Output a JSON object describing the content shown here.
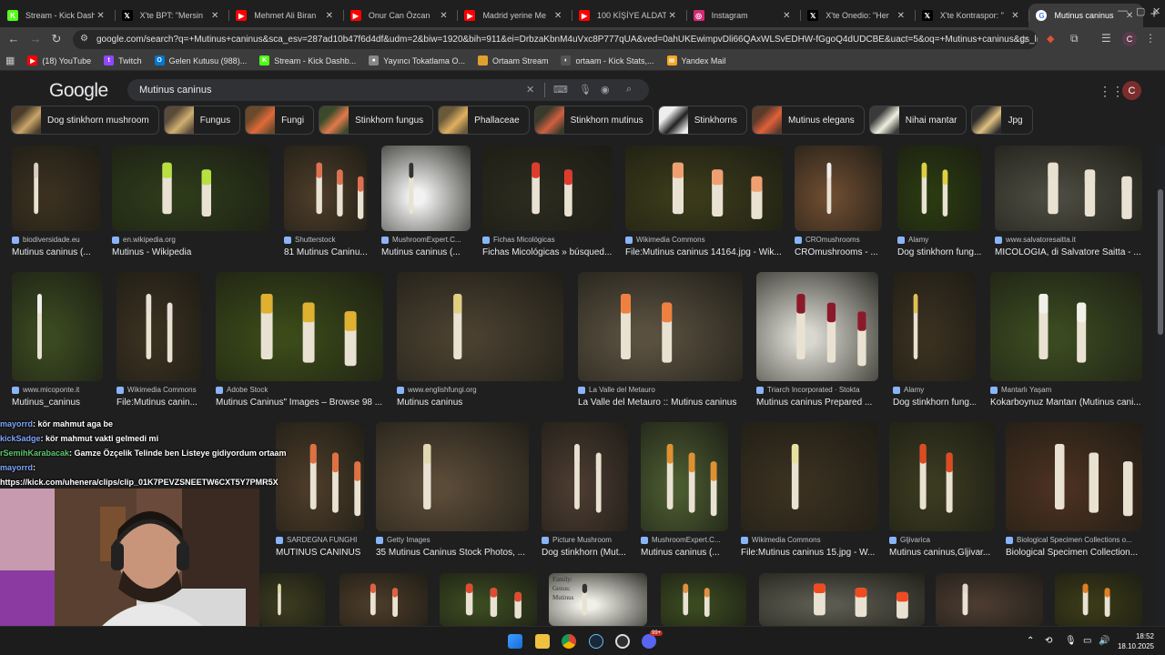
{
  "tabs": [
    {
      "label": "Stream - Kick Dashboard",
      "icon": "kick-icon",
      "color": "#53fc18",
      "glyph": "K",
      "active": false
    },
    {
      "label": "X'te BPT: \"Mersin",
      "icon": "x-icon",
      "color": "#000000",
      "glyph": "𝕏",
      "active": false
    },
    {
      "label": "Mehmet Ali Biran",
      "icon": "youtube-icon",
      "color": "#ff0000",
      "glyph": "▶",
      "active": false
    },
    {
      "label": "Onur Can Özcan",
      "icon": "youtube-icon",
      "color": "#ff0000",
      "glyph": "▶",
      "active": false
    },
    {
      "label": "Madrid yerine Me",
      "icon": "youtube-icon",
      "color": "#ff0000",
      "glyph": "▶",
      "active": false
    },
    {
      "label": "100 KİŞİYE ALDAT",
      "icon": "youtube-icon",
      "color": "#ff0000",
      "glyph": "▶",
      "active": false
    },
    {
      "label": "Instagram",
      "icon": "instagram-icon",
      "color": "#d62976",
      "glyph": "◎",
      "active": false
    },
    {
      "label": "X'te Onedio: \"Her",
      "icon": "x-icon",
      "color": "#000000",
      "glyph": "𝕏",
      "active": false
    },
    {
      "label": "X'te Kontraspor: \"",
      "icon": "x-icon",
      "color": "#000000",
      "glyph": "𝕏",
      "active": false
    },
    {
      "label": "Mutinus caninus",
      "icon": "google-icon",
      "color": "#ffffff",
      "glyph": "G",
      "active": true
    }
  ],
  "address": {
    "url": "google.com/search?q=+Mutinus+caninus&sca_esv=287ad10b47f6d4df&udm=2&biw=1920&bih=911&ei=DrbzaKbnM4uVxc8P777qUA&ved=0ahUKEwimpvDli66QAxWLSvEDHW-fGgoQ4dUDCBE&uact=5&oq=+Mutinus+caninus&gs_lp=Egtn..."
  },
  "bookmarks": [
    {
      "label": "(18) YouTube",
      "icon": "youtube-icon",
      "color": "#ff0000",
      "glyph": "▶"
    },
    {
      "label": "Twitch",
      "icon": "twitch-icon",
      "color": "#9146ff",
      "glyph": "t"
    },
    {
      "label": "Gelen Kutusu (988)...",
      "icon": "outlook-icon",
      "color": "#0078d4",
      "glyph": "O"
    },
    {
      "label": "Stream - Kick Dashb...",
      "icon": "kick-icon",
      "color": "#53fc18",
      "glyph": "K"
    },
    {
      "label": "Yayıncı Tokatlama O...",
      "icon": "site-icon",
      "color": "#888888",
      "glyph": "●"
    },
    {
      "label": "Ortaam Stream",
      "icon": "folder-icon",
      "color": "#e0a030",
      "glyph": ""
    },
    {
      "label": "ortaam - Kick Stats,...",
      "icon": "kickstats-icon",
      "color": "#555555",
      "glyph": "◐"
    },
    {
      "label": "Yandex Mail",
      "icon": "yandex-mail-icon",
      "color": "#f5a623",
      "glyph": "✉"
    }
  ],
  "google": {
    "logo": "Google",
    "query": "Mutinus caninus",
    "avatar_letter": "C",
    "chips": [
      {
        "label": "Dog stinkhorn mushroom",
        "colors": [
          "#4a3b2a",
          "#c9a56a"
        ]
      },
      {
        "label": "Fungus",
        "colors": [
          "#5a4a3a",
          "#d0b070"
        ]
      },
      {
        "label": "Fungi",
        "colors": [
          "#6a4a2a",
          "#e06a3a"
        ]
      },
      {
        "label": "Stinkhorn fungus",
        "colors": [
          "#3a4a2a",
          "#e07a4a"
        ]
      },
      {
        "label": "Phallaceae",
        "colors": [
          "#6a5a3a",
          "#e0b060"
        ]
      },
      {
        "label": "Stinkhorn mutinus",
        "colors": [
          "#3a3a2a",
          "#d06040"
        ]
      },
      {
        "label": "Stinkhorns",
        "colors": [
          "#eeeeee",
          "#222222"
        ]
      },
      {
        "label": "Mutinus elegans",
        "colors": [
          "#5a3a2a",
          "#e0603a"
        ]
      },
      {
        "label": "Nihai mantar",
        "colors": [
          "#3a3a3a",
          "#f0f0e0"
        ]
      },
      {
        "label": "Jpg",
        "colors": [
          "#2a2a2a",
          "#e0c080"
        ]
      }
    ]
  },
  "results": {
    "row1": [
      {
        "source": "biodiversidade.eu",
        "title": "Mutinus caninus (...",
        "c1": "#3b3020",
        "c2": "#d8cfc0"
      },
      {
        "source": "en.wikipedia.org",
        "title": "Mutinus - Wikipedia",
        "c1": "#2d3a1a",
        "c2": "#b8e040"
      },
      {
        "source": "Shutterstock",
        "title": "81 Mutinus Caninu...",
        "c1": "#4a3a28",
        "c2": "#e07050"
      },
      {
        "source": "MushroomExpert.C...",
        "title": "Mutinus caninus (...",
        "c1": "#f2f2f2",
        "c2": "#333333"
      },
      {
        "source": "Fichas Micológicas",
        "title": "Fichas Micológicas » búsqued...",
        "c1": "#2a2a1e",
        "c2": "#e03a2a"
      },
      {
        "source": "Wikimedia Commons",
        "title": "File:Mutinus caninus 14164.jpg - Wik...",
        "c1": "#3a3a1a",
        "c2": "#f0a070"
      },
      {
        "source": "CROmushrooms",
        "title": "CROmushrooms - ...",
        "c1": "#6a4a30",
        "c2": "#eeeeee"
      },
      {
        "source": "Alamy",
        "title": "Dog stinkhorn fung...",
        "c1": "#2a3a10",
        "c2": "#e0d040"
      },
      {
        "source": "www.salvatoresaitta.it",
        "title": "MICOLOGIA, di Salvatore Saitta - ...",
        "c1": "#4a4a40",
        "c2": "#e8e0d0"
      }
    ],
    "row2": [
      {
        "source": "www.micoponte.it",
        "title": "Mutinus_caninus",
        "c1": "#3a4a20",
        "c2": "#eeeeee"
      },
      {
        "source": "Wikimedia Commons",
        "title": "File:Mutinus canin...",
        "c1": "#3a3020",
        "c2": "#e8e0d8"
      },
      {
        "source": "Adobe Stock",
        "title": "Mutinus Caninus\" Images – Browse 98 ...",
        "c1": "#3a4a18",
        "c2": "#e0b030"
      },
      {
        "source": "www.englishfungi.org",
        "title": "Mutinus caninus",
        "c1": "#4a4030",
        "c2": "#e0d080"
      },
      {
        "source": "La Valle del Metauro",
        "title": "La Valle del Metauro :: Mutinus caninus",
        "c1": "#5a5040",
        "c2": "#f08040"
      },
      {
        "source": "Triarch Incorporated · Stokta",
        "title": "Mutinus caninus Prepared ...",
        "c1": "#d8d8d0",
        "c2": "#8a1a2a"
      },
      {
        "source": "Alamy",
        "title": "Dog stinkhorn fung...",
        "c1": "#3a3020",
        "c2": "#e0c050"
      },
      {
        "source": "Mantarlı Yaşam",
        "title": "Kokarboynuz Mantarı (Mutinus cani...",
        "c1": "#3a4a20",
        "c2": "#f0f0e8"
      }
    ],
    "row3": [
      {
        "source": "SARDEGNA FUNGHI",
        "title": "MUTINUS CANINUS",
        "c1": "#4a3a28",
        "c2": "#e07040"
      },
      {
        "source": "Getty Images",
        "title": "35 Mutinus Caninus Stock Photos, ...",
        "c1": "#5a4a38",
        "c2": "#e0d8b0"
      },
      {
        "source": "Picture Mushroom",
        "title": "Dog stinkhorn (Mut...",
        "c1": "#4a3a30",
        "c2": "#e8e0d0"
      },
      {
        "source": "MushroomExpert.C...",
        "title": "Mutinus caninus (...",
        "c1": "#4a5a30",
        "c2": "#e09030"
      },
      {
        "source": "Wikimedia Commons",
        "title": "File:Mutinus caninus 15.jpg - W...",
        "c1": "#3a3020",
        "c2": "#e8e0a0"
      },
      {
        "source": "Gljivarica",
        "title": "Mutinus caninus,Gljivar...",
        "c1": "#3a3a20",
        "c2": "#e04a20"
      },
      {
        "source": "Biological Specimen Collections o...",
        "title": "Biological Specimen Collection...",
        "c1": "#4a3020",
        "c2": "#e8e0d0"
      }
    ],
    "row4": [
      {
        "c1": "#3a3a20",
        "c2": "#d8d8a0"
      },
      {
        "c1": "#4a3a28",
        "c2": "#e06040"
      },
      {
        "c1": "#3a4a20",
        "c2": "#e04a30"
      },
      {
        "c1": "#f0f0e8",
        "c2": "#333333",
        "note": [
          "Family:",
          "Genus:",
          "Mutinus"
        ]
      },
      {
        "c1": "#3a4a20",
        "c2": "#e09040"
      },
      {
        "c1": "#5a5a50",
        "c2": "#f04a20"
      },
      {
        "c1": "#4a3a30",
        "c2": "#e0d8c8"
      },
      {
        "c1": "#3a3a18",
        "c2": "#e08020"
      }
    ]
  },
  "chat": [
    {
      "user": "mayorrd",
      "text": ": kör mahmut aga be",
      "ucolor": "#7fa6ff"
    },
    {
      "user": "kickSadge",
      "text": ": kör mahmut vakti gelmedi mi",
      "ucolor": "#7fa6ff"
    },
    {
      "user": "rSemihKarabacak",
      "text": ": Gamze Özçelik Telinde ben Listeye gidiyordum ortaam",
      "ucolor": "#5ec66e"
    },
    {
      "user": "mayorrd",
      "text": ":",
      "ucolor": "#7fa6ff"
    },
    {
      "user": "",
      "text": "https://kick.com/uhenera/clips/clip_01K7PEVZSNEETW6CXT5Y7PMR5X",
      "ucolor": "#ffffff"
    }
  ],
  "taskbar": {
    "time": "18:52",
    "date": "18.10.2025",
    "badge": "99+"
  }
}
